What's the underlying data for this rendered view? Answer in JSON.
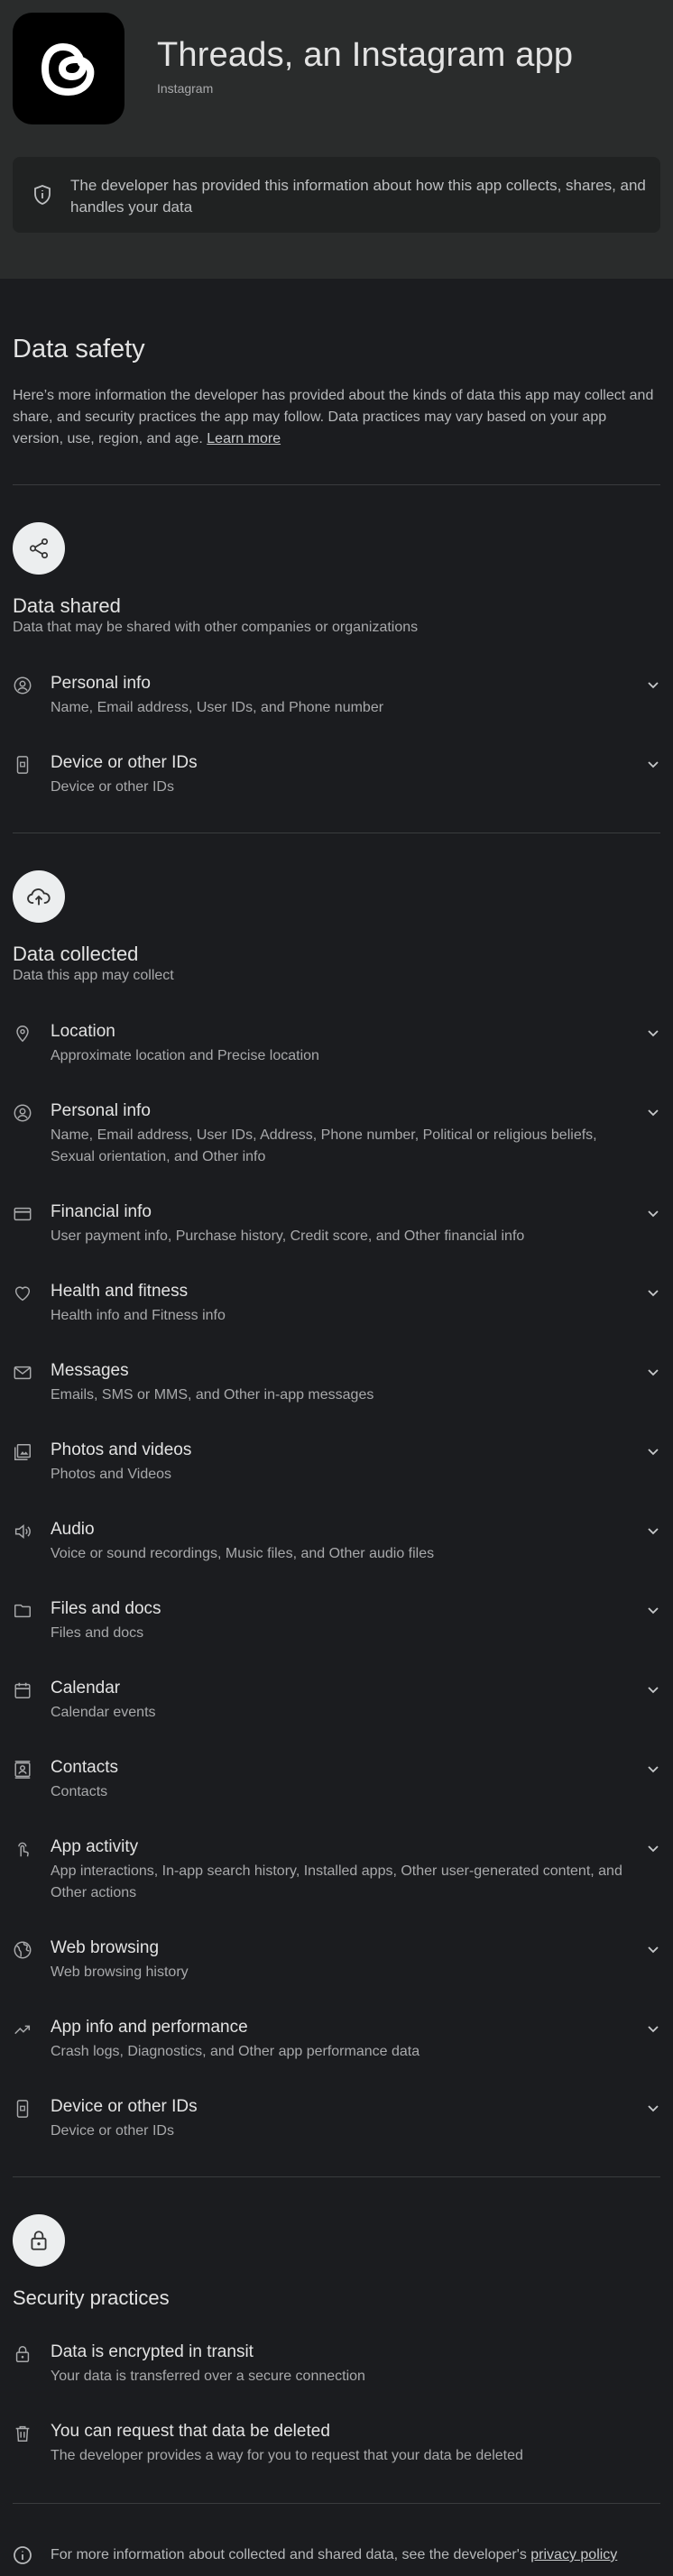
{
  "app": {
    "title": "Threads, an Instagram app",
    "developer": "Instagram",
    "notice": "The developer has provided this information about how this app collects, shares, and handles your data"
  },
  "data_safety": {
    "heading": "Data safety",
    "intro": "Here’s more information the developer has provided about the kinds of data this app may collect and share, and security practices the app may follow. Data practices may vary based on your app version, use, region, and age.",
    "learn_more": "Learn more"
  },
  "shared": {
    "icon": "share-icon",
    "title": "Data shared",
    "subtitle": "Data that may be shared with other companies or organizations",
    "items": [
      {
        "icon": "person-icon",
        "title": "Personal info",
        "detail": "Name, Email address, User IDs, and Phone number"
      },
      {
        "icon": "device-icon",
        "title": "Device or other IDs",
        "detail": "Device or other IDs"
      }
    ]
  },
  "collected": {
    "icon": "cloud-upload-icon",
    "title": "Data collected",
    "subtitle": "Data this app may collect",
    "items": [
      {
        "icon": "location-icon",
        "title": "Location",
        "detail": "Approximate location and Precise location"
      },
      {
        "icon": "person-icon",
        "title": "Personal info",
        "detail": "Name, Email address, User IDs, Address, Phone number, Political or religious beliefs, Sexual orientation, and Other info"
      },
      {
        "icon": "credit-card-icon",
        "title": "Financial info",
        "detail": "User payment info, Purchase history, Credit score, and Other financial info"
      },
      {
        "icon": "heart-icon",
        "title": "Health and fitness",
        "detail": "Health info and Fitness info"
      },
      {
        "icon": "mail-icon",
        "title": "Messages",
        "detail": "Emails, SMS or MMS, and Other in-app messages"
      },
      {
        "icon": "photos-icon",
        "title": "Photos and videos",
        "detail": "Photos and Videos"
      },
      {
        "icon": "volume-icon",
        "title": "Audio",
        "detail": "Voice or sound recordings, Music files, and Other audio files"
      },
      {
        "icon": "folder-icon",
        "title": "Files and docs",
        "detail": "Files and docs"
      },
      {
        "icon": "calendar-icon",
        "title": "Calendar",
        "detail": "Calendar events"
      },
      {
        "icon": "contacts-icon",
        "title": "Contacts",
        "detail": "Contacts"
      },
      {
        "icon": "touch-icon",
        "title": "App activity",
        "detail": "App interactions, In-app search history, Installed apps, Other user-generated content, and Other actions"
      },
      {
        "icon": "globe-icon",
        "title": "Web browsing",
        "detail": "Web browsing history"
      },
      {
        "icon": "trending-icon",
        "title": "App info and performance",
        "detail": "Crash logs, Diagnostics, and Other app performance data"
      },
      {
        "icon": "device-icon",
        "title": "Device or other IDs",
        "detail": "Device or other IDs"
      }
    ]
  },
  "security": {
    "icon": "lock-icon",
    "title": "Security practices",
    "items": [
      {
        "icon": "lock-icon",
        "title": "Data is encrypted in transit",
        "detail": "Your data is transferred over a secure connection"
      },
      {
        "icon": "trash-icon",
        "title": "You can request that data be deleted",
        "detail": "The developer provides a way for you to request that your data be deleted"
      }
    ]
  },
  "footer": {
    "text": "For more information about collected and shared data, see the developer's",
    "link": "privacy policy"
  }
}
